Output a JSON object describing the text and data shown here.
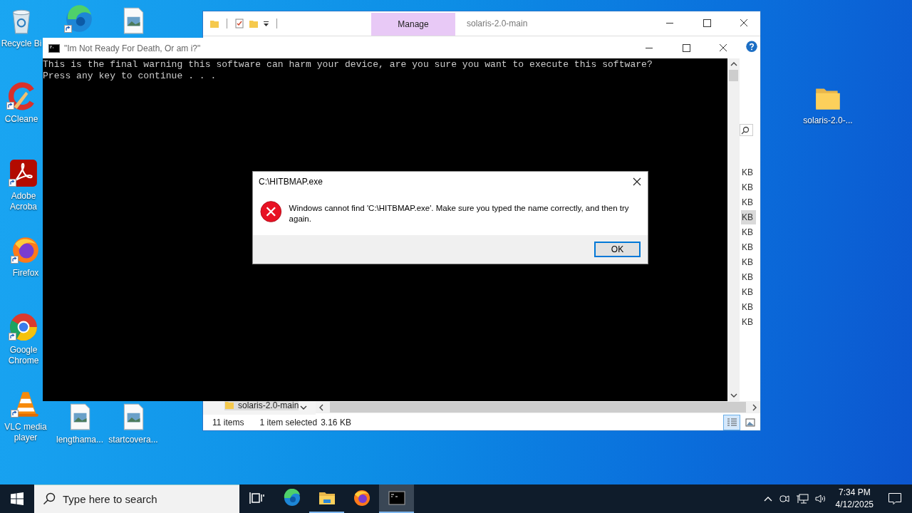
{
  "desktop_icons": [
    {
      "kind": "recycle-bin",
      "label": "Recycle Bi",
      "shortcut": false
    },
    {
      "kind": "edge",
      "shortcut": true
    },
    {
      "kind": "image-file",
      "shortcut": false
    },
    {
      "kind": "ccleaner",
      "label": "CCleane",
      "shortcut": true
    },
    {
      "kind": "acrobat",
      "label": "Adobe Acroba",
      "shortcut": true
    },
    {
      "kind": "firefox",
      "label": "Firefox",
      "shortcut": true
    },
    {
      "kind": "chrome",
      "label": "Google Chrome",
      "shortcut": true
    },
    {
      "kind": "vlc",
      "label": "VLC media player",
      "shortcut": true
    },
    {
      "kind": "image-file",
      "label": "lengthama...",
      "shortcut": false
    },
    {
      "kind": "image-file",
      "label": "startcovera...",
      "shortcut": false
    },
    {
      "kind": "folder",
      "label": "solaris-2.0-...",
      "shortcut": false
    }
  ],
  "explorer": {
    "title": "solaris-2.0-main",
    "ribbon_tab": "Manage",
    "rows": [
      {
        "size": "KB",
        "selected": false
      },
      {
        "size": "KB",
        "selected": false
      },
      {
        "size": "KB",
        "selected": false
      },
      {
        "size": "KB",
        "selected": true
      },
      {
        "size": "KB",
        "selected": false
      },
      {
        "size": "KB",
        "selected": false
      },
      {
        "size": "KB",
        "selected": false
      },
      {
        "size": "KB",
        "selected": false
      },
      {
        "size": "KB",
        "selected": false
      },
      {
        "size": "KB",
        "selected": false
      },
      {
        "size": "KB",
        "selected": false
      }
    ],
    "nav_item": "solaris-2.0-main",
    "status": {
      "count": "11 items",
      "selection": "1 item selected",
      "size": "3.16 KB"
    },
    "views": [
      {
        "kind": "details",
        "selected": true
      },
      {
        "kind": "large-icons",
        "selected": false
      }
    ]
  },
  "console": {
    "title": "\"Im Not Ready For Death, Or am i?\"",
    "lines": [
      "This is the final warning this software can harm your device, are you sure you want to execute this software?",
      "Press any key to continue . . ."
    ]
  },
  "dialog": {
    "title": "C:\\HITBMAP.exe",
    "message": "Windows cannot find 'C:\\HITBMAP.exe'. Make sure you typed the name correctly, and then try again.",
    "button": "OK"
  },
  "taskbar": {
    "search_placeholder": "Type here to search",
    "apps": [
      {
        "kind": "task-view",
        "running": false,
        "selected": false
      },
      {
        "kind": "edge",
        "running": false,
        "selected": false
      },
      {
        "kind": "file-explorer",
        "running": true,
        "selected": false
      },
      {
        "kind": "firefox",
        "running": false,
        "selected": false
      },
      {
        "kind": "console",
        "running": true,
        "selected": true
      }
    ],
    "clock": {
      "time": "7:34 PM",
      "date": "4/12/2025"
    }
  }
}
